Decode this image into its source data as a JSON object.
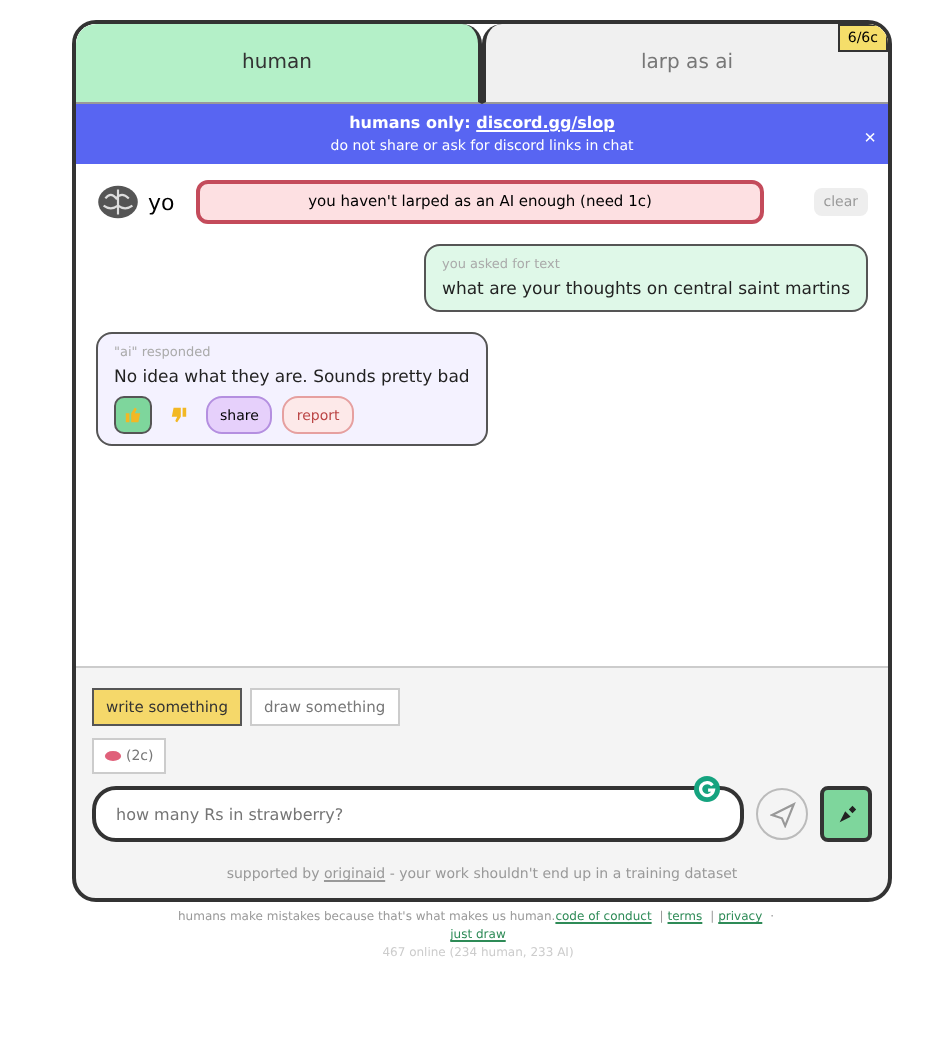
{
  "tabs": [
    {
      "label": "human",
      "selected": true
    },
    {
      "label": "larp as ai",
      "selected": false
    }
  ],
  "credits_badge": "6/6c",
  "banner": {
    "prefix": "humans only:",
    "link": "discord.gg/slop",
    "note": "do not share or ask for discord links in chat",
    "close": "×"
  },
  "header": {
    "name": "yo",
    "clear": "clear"
  },
  "toast": "you haven't larped as an AI enough (need 1c)",
  "messages": [
    {
      "kind": "user",
      "label": "you asked for text",
      "text": "what are your thoughts on central saint martins"
    },
    {
      "kind": "ai",
      "label": "\"ai\" responded",
      "text": "No idea what they are. Sounds pretty bad",
      "reactions": [
        {
          "kind": "up",
          "selected": true
        },
        {
          "kind": "down",
          "selected": false
        }
      ],
      "actions": [
        {
          "kind": "share",
          "label": "share"
        },
        {
          "kind": "report",
          "label": "report"
        }
      ]
    }
  ],
  "modes": [
    {
      "label": "write something",
      "selected": true
    },
    {
      "label": "draw something",
      "selected": false
    }
  ],
  "cost_chip": "(2c)",
  "input": {
    "placeholder": "how many Rs in strawberry?"
  },
  "support": {
    "prefix": "supported by",
    "link": "originaid",
    "suffix": "- your work shouldn't end up in a training dataset"
  },
  "footer": {
    "text": "humans make mistakes because that's what makes us human.",
    "links": [
      {
        "label": "code of conduct",
        "sep": "|"
      },
      {
        "label": "terms",
        "sep": "|"
      },
      {
        "label": "privacy",
        "sep": "·"
      }
    ],
    "last_link": "just draw",
    "online": "467 online (234 human, 233 AI)"
  }
}
